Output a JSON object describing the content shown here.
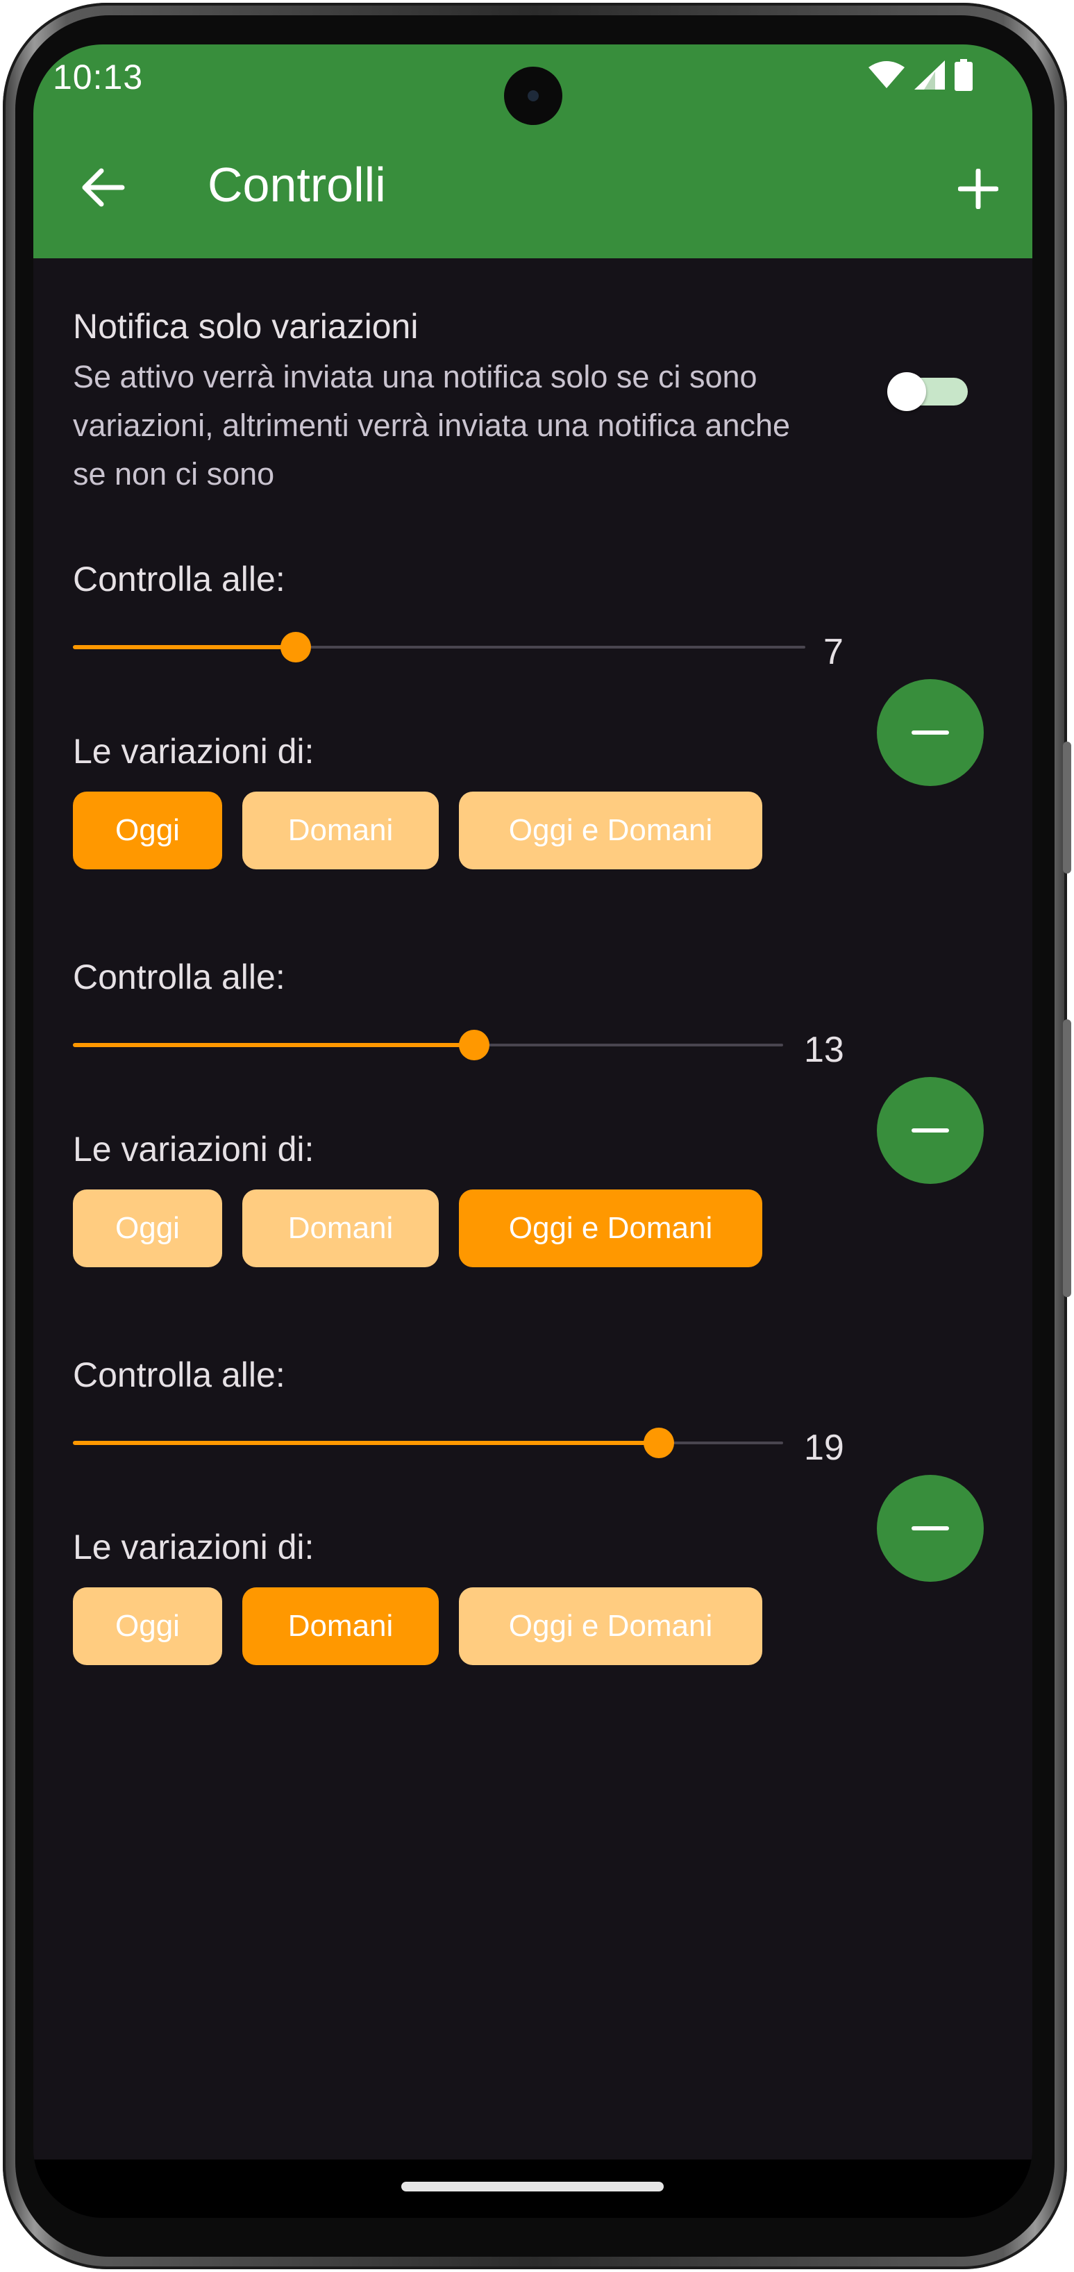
{
  "status_bar": {
    "time": "10:13",
    "icons": [
      "wifi-icon",
      "signal-icon",
      "battery-icon"
    ]
  },
  "app_bar": {
    "title": "Controlli",
    "back_icon": "arrow-back-icon",
    "add_icon": "plus-icon"
  },
  "notification_setting": {
    "title": "Notifica solo variazioni",
    "description": "Se attivo verrà inviata una notifica solo se ci sono variazioni, altrimenti verrà inviata una notifica anche se non ci sono",
    "enabled": false
  },
  "controls": [
    {
      "label": "Controlla alle:",
      "hour": "7",
      "variations_label": "Le variazioni di:",
      "options": [
        "Oggi",
        "Domani",
        "Oggi e Domani"
      ],
      "selected": "Oggi"
    },
    {
      "label": "Controlla alle:",
      "hour": "13",
      "variations_label": "Le variazioni di:",
      "options": [
        "Oggi",
        "Domani",
        "Oggi e Domani"
      ],
      "selected": "Oggi e Domani"
    },
    {
      "label": "Controlla alle:",
      "hour": "19",
      "variations_label": "Le variazioni di:",
      "options": [
        "Oggi",
        "Domani",
        "Oggi e Domani"
      ],
      "selected": "Domani"
    }
  ],
  "colors": {
    "app_bar": "#388e3c",
    "accent": "#ff9800",
    "accent_light": "#ffcc80",
    "background": "#151218"
  }
}
